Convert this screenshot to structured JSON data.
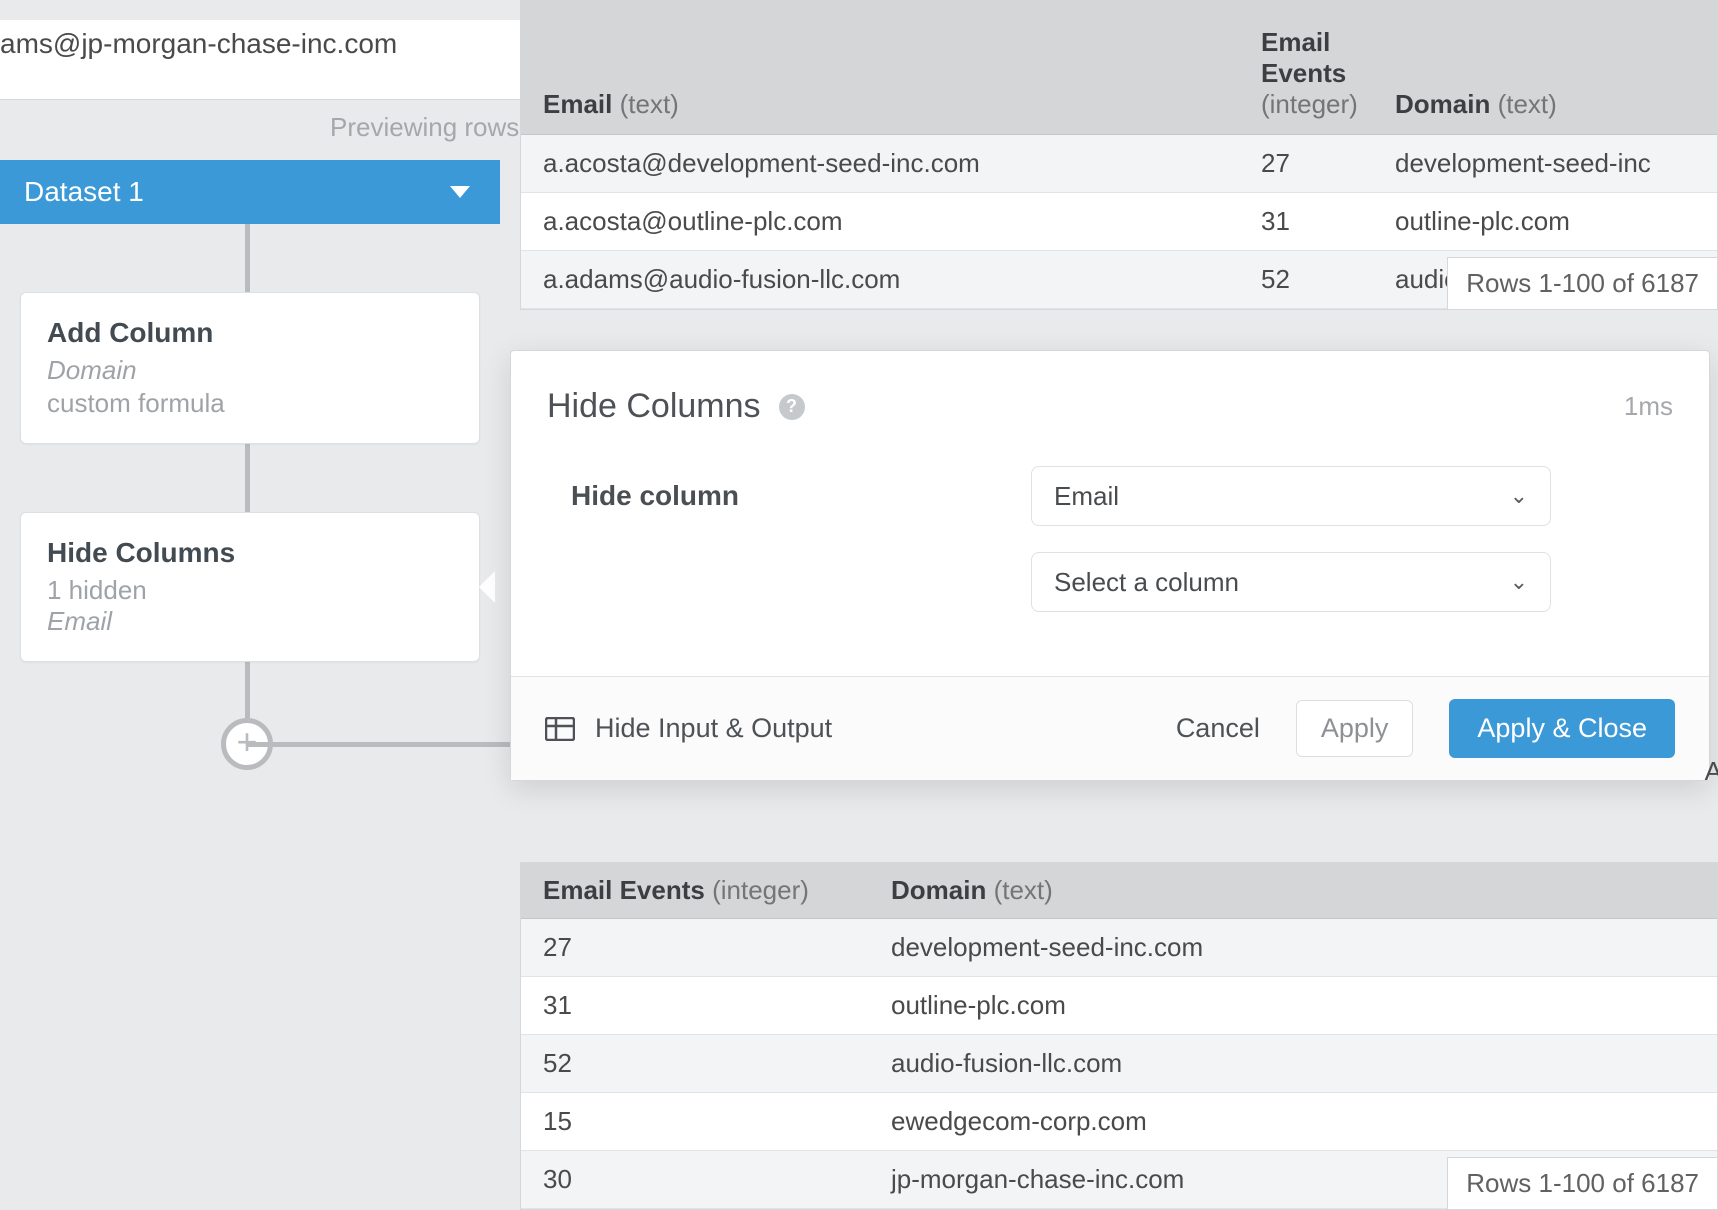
{
  "top_fragment_email": "ams@jp-morgan-chase-inc.com",
  "previewing_label": "Previewing rows",
  "pipeline": {
    "dataset_label": "Dataset 1",
    "step1": {
      "title": "Add Column",
      "sub1": "Domain",
      "sub2": "custom formula"
    },
    "step2": {
      "title": "Hide Columns",
      "sub1": "1 hidden",
      "sub2": "Email"
    }
  },
  "input_table": {
    "columns": {
      "email": {
        "name": "Email",
        "type": "(text)"
      },
      "events": {
        "name": "Email Events",
        "type": "(integer)"
      },
      "domain": {
        "name": "Domain",
        "type": "(text)"
      }
    },
    "rows": [
      {
        "email": "a.acosta@development-seed-inc.com",
        "events": "27",
        "domain": "development-seed-inc"
      },
      {
        "email": "a.acosta@outline-plc.com",
        "events": "31",
        "domain": "outline-plc.com"
      },
      {
        "email": "a.adams@audio-fusion-llc.com",
        "events": "52",
        "domain": "audio-fusion-llc.com"
      }
    ],
    "row_count": "Rows 1-100 of 6187"
  },
  "panel": {
    "title": "Hide Columns",
    "time": "1ms",
    "form_label": "Hide column",
    "select1": "Email",
    "select2": "Select a column",
    "footer": {
      "hide_io": "Hide Input & Output",
      "cancel": "Cancel",
      "apply": "Apply",
      "apply_close": "Apply & Close"
    }
  },
  "output_table": {
    "columns": {
      "events": {
        "name": "Email Events",
        "type": "(integer)"
      },
      "domain": {
        "name": "Domain",
        "type": "(text)"
      }
    },
    "rows": [
      {
        "events": "27",
        "domain": "development-seed-inc.com"
      },
      {
        "events": "31",
        "domain": "outline-plc.com"
      },
      {
        "events": "52",
        "domain": "audio-fusion-llc.com"
      },
      {
        "events": "15",
        "domain": "ewedgecom-corp.com"
      },
      {
        "events": "30",
        "domain": "jp-morgan-chase-inc.com"
      }
    ],
    "row_count": "Rows 1-100 of 6187"
  },
  "truncated_char": "A"
}
